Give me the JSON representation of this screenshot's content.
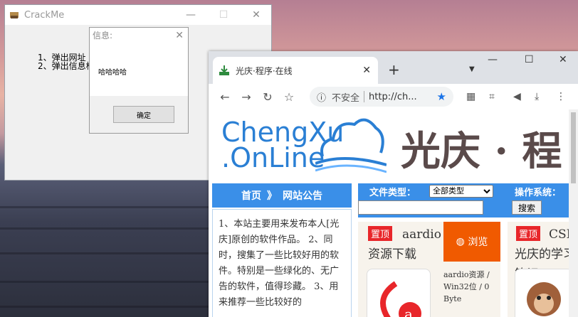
{
  "crackme": {
    "title": "CrackMe",
    "line1": "1、弹出网址",
    "line2": "2、弹出信息框"
  },
  "dialog": {
    "title": "信息:",
    "message": "哈哈哈哈",
    "ok": "确定"
  },
  "browser": {
    "tab_title": "光庆·程序·在线",
    "new_tab": "+",
    "insecure": "不安全",
    "url": "http://ch..."
  },
  "site": {
    "logo_line1": "ChengXu",
    "logo_line2": ".OnLine",
    "logo_cn": "光庆 · 程",
    "nav_home": "首页",
    "nav_sep": "》",
    "nav_notice": "网站公告",
    "notice": "1、本站主要用来发布本人[光庆]原创的软件作品。 2、同时，搜集了一些比较好用的软件。特别是一些绿化的、无广告的软件，值得珍藏。 3、用来推荐一些比较好的",
    "file_type_label": "文件类型：",
    "file_type_value": "全部类型",
    "os_label": "操作系统：",
    "search_btn": "搜索",
    "card1": {
      "badge": "置顶",
      "title": "aardio 资源下载",
      "browse": "浏览",
      "desc": "aardio资源 / Win32位 / 0 Byte"
    },
    "card2": {
      "badge": "置顶",
      "title": "CSD 光庆的学习笔记"
    }
  }
}
